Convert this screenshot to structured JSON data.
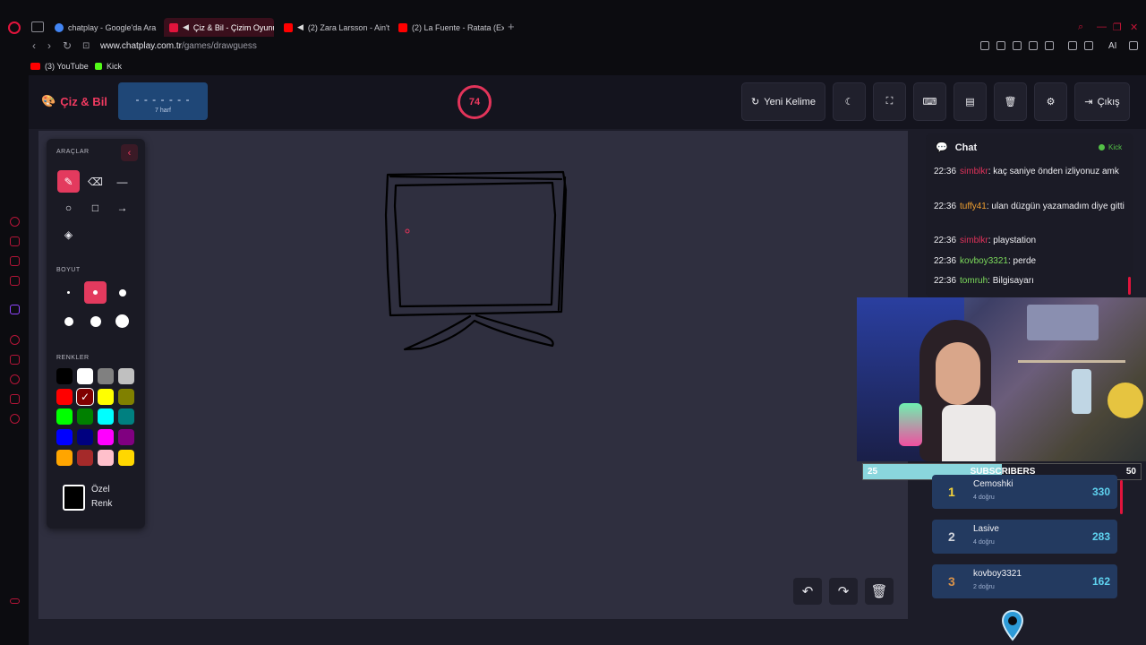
{
  "browser": {
    "tabs": [
      {
        "label": "chatplay - Google'da Ara",
        "favicon_color": "#4285f4"
      },
      {
        "label": "Çiz & Bil - Çizim Oyunu",
        "favicon_color": "#e1143c",
        "active": true
      },
      {
        "label": "(2) Zara Larsson - Ain't",
        "favicon_color": "#ff0000"
      },
      {
        "label": "(2) La Fuente - Ratata (Ext",
        "favicon_color": "#ff0000"
      }
    ],
    "url_domain": "www.chatplay.com.tr",
    "url_path": "/games/drawguess",
    "ai_label": "AI",
    "bookmarks": [
      {
        "label": "(3) YouTube",
        "color": "#ff0000"
      },
      {
        "label": "Kick",
        "color": "#53fc18"
      }
    ]
  },
  "header": {
    "brand": "Çiz & Bil",
    "word_mask": "- - - - - - -",
    "word_hint": "7 harf",
    "timer": "74",
    "new_word_label": "Yeni Kelime",
    "exit_label": "Çıkış"
  },
  "tools": {
    "tools_title": "ARAÇLAR",
    "size_title": "BOYUT",
    "colors_title": "RENKLER",
    "custom_color_line1": "Özel",
    "custom_color_line2": "Renk",
    "palette": [
      "#000000",
      "#ffffff",
      "#808080",
      "#c0c0c0",
      "#ff0000",
      "#800000",
      "#ffff00",
      "#808000",
      "#00ff00",
      "#008000",
      "#00ffff",
      "#008080",
      "#0000ff",
      "#000080",
      "#ff00ff",
      "#800080",
      "#ffa500",
      "#a52a2a",
      "#ffc0cb",
      "#ffd700"
    ]
  },
  "chat": {
    "title": "Chat",
    "platform": "Kick",
    "messages": [
      {
        "time": "22:36",
        "user": "simblkr",
        "user_color": "#e0325a",
        "text": ": kaç saniye önden izliyonuz amk"
      },
      {
        "time": "22:36",
        "user": "tuffy41",
        "user_color": "#f0a030",
        "text": ": ulan düzgün yazamadım diye gitti"
      },
      {
        "time": "22:36",
        "user": "simblkr",
        "user_color": "#e0325a",
        "text": ": playstation"
      },
      {
        "time": "22:36",
        "user": "kovboy3321",
        "user_color": "#7ddc5c",
        "text": ": perde"
      },
      {
        "time": "22:36",
        "user": "tomruh",
        "user_color": "#7ddc5c",
        "text": ": Bilgisayarı"
      }
    ]
  },
  "subscribers": {
    "title": "SUBSCRIBERS",
    "current": "25",
    "goal": "50",
    "progress": 0.5
  },
  "leaderboard": [
    {
      "rank": "1",
      "name": "Cemoshki",
      "sub": "4 doğru",
      "score": "330",
      "rank_color": "#f5d33a"
    },
    {
      "rank": "2",
      "name": "Lasive",
      "sub": "4 doğru",
      "score": "283",
      "rank_color": "#d0d4dc"
    },
    {
      "rank": "3",
      "name": "kovboy3321",
      "sub": "2 doğru",
      "score": "162",
      "rank_color": "#d8924a"
    }
  ]
}
